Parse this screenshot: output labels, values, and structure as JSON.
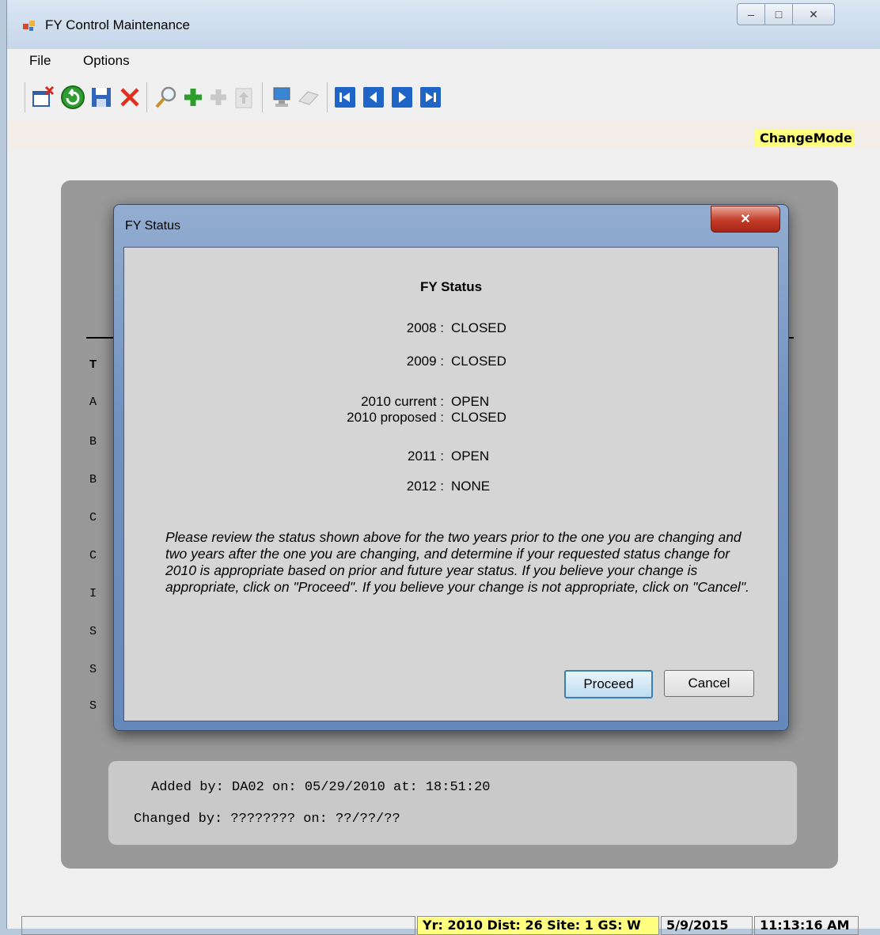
{
  "window": {
    "title": "FY Control Maintenance",
    "controls": {
      "minimize": "–",
      "maximize": "□",
      "close": "✕"
    }
  },
  "menu": {
    "items": [
      "File",
      "Options"
    ]
  },
  "toolbar": {
    "icons": [
      "exit-window-icon",
      "undo-green-icon",
      "save-icon",
      "delete-x-icon",
      "find-magnifier-icon",
      "add-plus-icon",
      "add-disabled-icon",
      "move-up-disabled-icon",
      "computer-icon",
      "eraser-icon",
      "first-record-icon",
      "prev-record-icon",
      "next-record-icon",
      "last-record-icon"
    ],
    "colors": {
      "delete": "#e0301e",
      "add": "#2d9e2d",
      "nav": "#1f65c8"
    }
  },
  "mode_badge": "ChangeMode",
  "background_form": {
    "letters": [
      "T",
      "A",
      "B",
      "B",
      "C",
      "C",
      "I",
      "S",
      "S",
      "S"
    ],
    "audit": {
      "added": "Added by: DA02 on: 05/29/2010 at: 18:51:20",
      "changed": "Changed by: ???????? on: ??/??/??"
    }
  },
  "dialog": {
    "title": "FY Status",
    "close_label": "✕",
    "heading": "FY Status",
    "rows": [
      {
        "label": "2008 :",
        "value": "CLOSED"
      },
      {
        "label": "2009 :",
        "value": "CLOSED"
      },
      {
        "label": "2010 current :",
        "value": "OPEN"
      },
      {
        "label": "2010 proposed :",
        "value": "CLOSED"
      },
      {
        "label": "2011 :",
        "value": "OPEN"
      },
      {
        "label": "2012 :",
        "value": "NONE"
      }
    ],
    "message": "Please review the status shown above for the two years prior to the one you are changing and two years after the one you are changing, and determine if your requested status change for 2010 is appropriate based on prior and future year status. If you believe your change is appropriate, click on \"Proceed\". If you believe your change is not appropriate, click on \"Cancel\".",
    "buttons": {
      "proceed": "Proceed",
      "cancel": "Cancel"
    }
  },
  "status_bar": {
    "context": "Yr: 2010 Dist: 26 Site: 1 GS: W",
    "date": "5/9/2015",
    "time": "11:13:16 AM"
  }
}
